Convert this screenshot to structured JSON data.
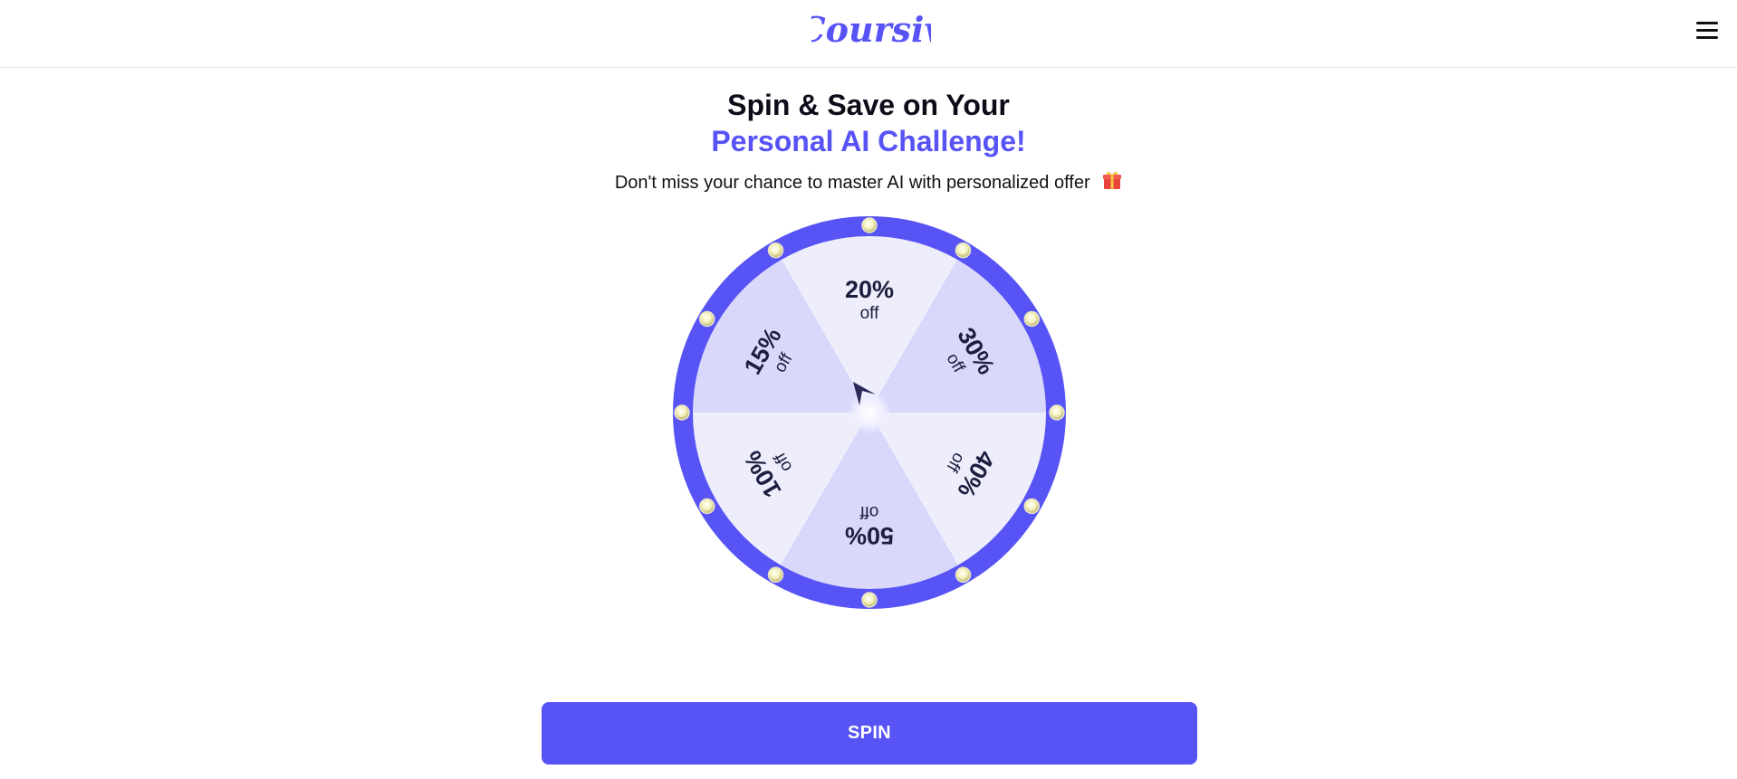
{
  "header": {
    "logo_text": "Coursiv",
    "menu_icon": "hamburger-menu-icon"
  },
  "main": {
    "title_line1": "Spin & Save on Your",
    "title_line2": "Personal AI Challenge!",
    "subtitle": "Don't miss your chance to master AI with personalized offer",
    "subtitle_icon": "gift-icon"
  },
  "wheel": {
    "segments": [
      {
        "value": "20%",
        "suffix": "off"
      },
      {
        "value": "30%",
        "suffix": "off"
      },
      {
        "value": "40%",
        "suffix": "off"
      },
      {
        "value": "50%",
        "suffix": "off"
      },
      {
        "value": "10%",
        "suffix": "off"
      },
      {
        "value": "15%",
        "suffix": "off"
      }
    ],
    "pointer_icon": "pointer-arrow-icon"
  },
  "actions": {
    "spin_label": "SPIN"
  },
  "colors": {
    "accent": "#5753f5",
    "segment_light": "#ededfc",
    "segment_dark": "#d9d8fb",
    "bulb": "#f3efb0",
    "text_dark": "#1e1d3f"
  }
}
